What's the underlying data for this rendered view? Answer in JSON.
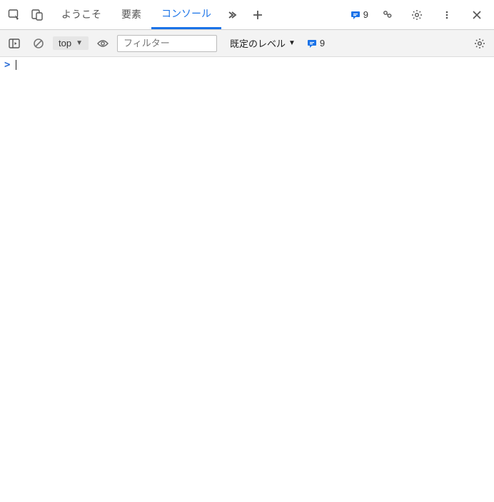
{
  "tabs": {
    "welcome": "ようこそ",
    "elements": "要素",
    "console": "コンソール"
  },
  "badges": {
    "issues_count": "9"
  },
  "toolbar": {
    "context": "top",
    "filter_placeholder": "フィルター",
    "level_label": "既定のレベル",
    "issues_count": "9"
  },
  "prompt": ">"
}
